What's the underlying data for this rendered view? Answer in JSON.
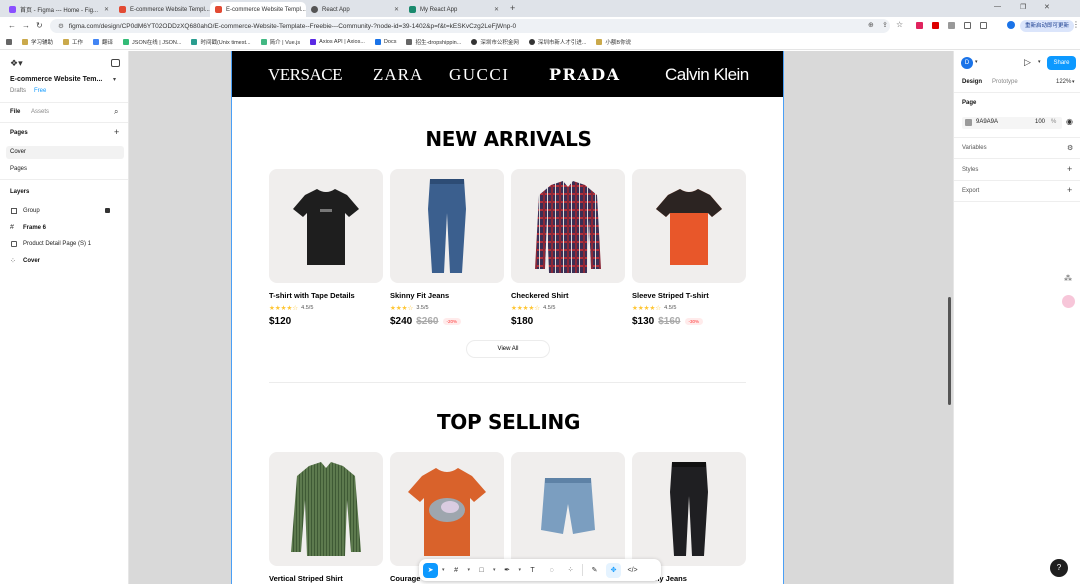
{
  "browser": {
    "tabs": [
      {
        "title": "首页 - Figma --- Home - Fig...",
        "color": "#8a4fff"
      },
      {
        "title": "E-commerce Website Templ...",
        "color": "#e24a33"
      },
      {
        "title": "E-commerce Website Templ...",
        "color": "#e24a33",
        "active": true
      },
      {
        "title": "React App",
        "color": "#555"
      },
      {
        "title": "My React App",
        "color": "#1a8a6e"
      }
    ],
    "new_tab": "+",
    "url": "figma.com/design/CP0dM6YT02ODDzXQ680ahO/E-commerce-Website-Template--Freebie---Community-?node-id=39-1402&p=f&t=kESKvCzg2LeFjWnp-0",
    "update_label": "重新启动即可更新",
    "bookmarks": [
      "学习辅助",
      "工作",
      "翻译",
      "JSON在线 | JSON...",
      "时间戳(Unix timest...",
      "简介 | Vue.js",
      "Axios API | Axios...",
      "Docs",
      "招生-dropshippin...",
      "深圳市公积金网",
      "深圳市新人才引进...",
      "小额B你说"
    ]
  },
  "left_panel": {
    "file_title": "E-commerce Website Tem...",
    "drafts": "Drafts",
    "plan": "Free",
    "tab_file": "File",
    "tab_assets": "Assets",
    "pages_heading": "Pages",
    "pages": [
      "Cover",
      "Pages"
    ],
    "layers_heading": "Layers",
    "layers": [
      {
        "name": "Group",
        "icon": "group-icon",
        "locked": true
      },
      {
        "name": "Frame 6",
        "icon": "frame-icon",
        "bold": true
      },
      {
        "name": "Product Detail Page (S) 1",
        "icon": "image-icon"
      },
      {
        "name": "Cover",
        "icon": "component-icon",
        "bold": true
      }
    ]
  },
  "design": {
    "brands": [
      "VERSACE",
      "ZARA",
      "GUCCI",
      "PRADA",
      "Calvin Klein"
    ],
    "new_arrivals": {
      "title": "NEW ARRIVALS",
      "view_all": "View All",
      "products": [
        {
          "name": "T-shirt with Tape Details",
          "rating": "4.5/5",
          "stars": "★★★★☆",
          "price": "$120",
          "old": "",
          "discount": "",
          "kind": "tshirt-black"
        },
        {
          "name": "Skinny Fit Jeans",
          "rating": "3.5/5",
          "stars": "★★★☆",
          "price": "$240",
          "old": "$260",
          "discount": "-20%",
          "kind": "jeans-blue"
        },
        {
          "name": "Checkered Shirt",
          "rating": "4.5/5",
          "stars": "★★★★☆",
          "price": "$180",
          "old": "",
          "discount": "",
          "kind": "shirt-check"
        },
        {
          "name": "Sleeve Striped T-shirt",
          "rating": "4.5/5",
          "stars": "★★★★☆",
          "price": "$130",
          "old": "$160",
          "discount": "-30%",
          "kind": "tshirt-orange"
        }
      ]
    },
    "top_selling": {
      "title": "TOP SELLING",
      "products": [
        {
          "name": "Vertical Striped Shirt",
          "kind": "shirt-green"
        },
        {
          "name": "Courage",
          "kind": "tshirt-graphic"
        },
        {
          "name": "",
          "kind": "shorts-denim"
        },
        {
          "name": "kinny Jeans",
          "kind": "jeans-black"
        }
      ]
    }
  },
  "right_panel": {
    "avatar": "D",
    "share": "Share",
    "tab_design": "Design",
    "tab_prototype": "Prototype",
    "zoom": "122%",
    "page_heading": "Page",
    "page_color": "9A9A9A",
    "page_opacity": "100",
    "percent": "%",
    "rows": [
      "Variables",
      "Styles",
      "Export"
    ]
  },
  "help": "?"
}
